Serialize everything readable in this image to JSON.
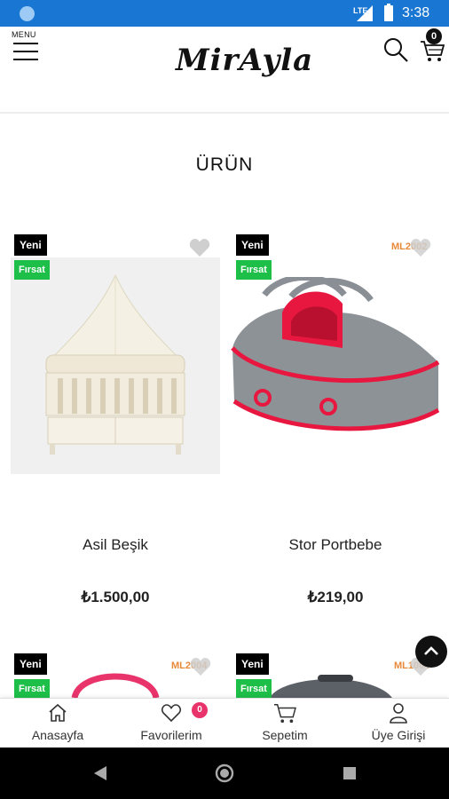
{
  "status_bar": {
    "network": "LTE",
    "time": "3:38"
  },
  "header": {
    "menu_label": "MENU",
    "logo_text": "MirAyla",
    "cart_count": "0"
  },
  "section_title": "ÜRÜN",
  "products": [
    {
      "badge_new": "Yeni",
      "badge_deal": "Fırsat",
      "sku": "",
      "name": "Asil Beşik",
      "price": "₺1.500,00"
    },
    {
      "badge_new": "Yeni",
      "badge_deal": "Fırsat",
      "sku": "ML2002",
      "name": "Stor Portbebe",
      "price": "₺219,00"
    },
    {
      "badge_new": "Yeni",
      "badge_deal": "Fırsat",
      "sku": "ML2004"
    },
    {
      "badge_new": "Yeni",
      "badge_deal": "Fırsat",
      "sku": "ML1004"
    }
  ],
  "bottom_nav": {
    "home": "Anasayfa",
    "favorites": "Favorilerim",
    "favorites_count": "0",
    "cart": "Sepetim",
    "login": "Üye Girişi"
  },
  "colors": {
    "status_bar": "#1976d2",
    "deal_badge": "#1dbf48",
    "sku": "#e8893a",
    "fav_badge": "#e8346a",
    "product_accent": "#e8173f"
  }
}
